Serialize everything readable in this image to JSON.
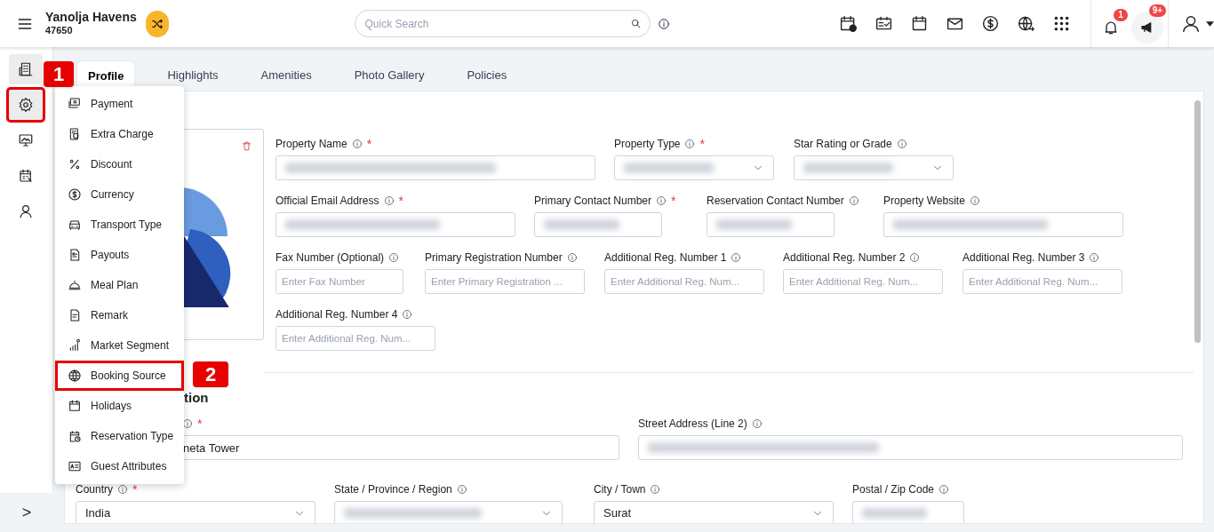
{
  "header": {
    "property_name": "Yanolja Havens",
    "property_id": "47650",
    "search": {
      "placeholder": "Quick Search"
    },
    "notifications_badge": "1",
    "announcements_badge": "9+"
  },
  "sidebar": {
    "items": [
      {
        "selected": true
      },
      {
        "selected": true,
        "callout": "1"
      },
      {
        "selected": false
      },
      {
        "selected": false
      },
      {
        "selected": false
      }
    ],
    "expand_label": ">"
  },
  "settings_menu": {
    "items": [
      {
        "label": "Payment"
      },
      {
        "label": "Extra Charge"
      },
      {
        "label": "Discount"
      },
      {
        "label": "Currency"
      },
      {
        "label": "Transport Type"
      },
      {
        "label": "Payouts"
      },
      {
        "label": "Meal Plan"
      },
      {
        "label": "Remark"
      },
      {
        "label": "Market Segment"
      },
      {
        "label": "Booking Source",
        "callout": "2"
      },
      {
        "label": "Holidays"
      },
      {
        "label": "Reservation Type"
      },
      {
        "label": "Guest Attributes"
      }
    ]
  },
  "tabs": [
    {
      "label": "Profile",
      "selected": true
    },
    {
      "label": "Highlights",
      "selected": false
    },
    {
      "label": "Amenities",
      "selected": false
    },
    {
      "label": "Photo Gallery",
      "selected": false
    },
    {
      "label": "Policies",
      "selected": false
    }
  ],
  "property_form": {
    "rows": [
      [
        {
          "label": "Property Name",
          "required_mark": "*",
          "kind": "text",
          "redacted": true
        },
        {
          "label": "Property Type",
          "required_mark": "*",
          "kind": "select",
          "redacted": true
        },
        {
          "label": "Star Rating or Grade",
          "kind": "select",
          "redacted": true
        }
      ],
      [
        {
          "label": "Official Email Address",
          "required_mark": "*",
          "kind": "text",
          "redacted": true
        },
        {
          "label": "Primary Contact Number",
          "required_mark": "*",
          "kind": "text",
          "redacted": true
        },
        {
          "label": "Reservation Contact Number",
          "kind": "text",
          "redacted": true
        },
        {
          "label": "Property Website",
          "kind": "text",
          "redacted": true
        }
      ],
      [
        {
          "label": "Fax Number (Optional)",
          "kind": "text",
          "placeholder": "Enter Fax Number"
        },
        {
          "label": "Primary Registration Number",
          "kind": "text",
          "placeholder": "Enter Primary Registration ..."
        },
        {
          "label": "Additional Reg. Number 1",
          "kind": "text",
          "placeholder": "Enter Additional Reg. Num..."
        },
        {
          "label": "Additional Reg. Number 2",
          "kind": "text",
          "placeholder": "Enter Additional Reg. Num..."
        },
        {
          "label": "Additional Reg. Number 3",
          "kind": "text",
          "placeholder": "Enter Additional Reg. Num..."
        }
      ],
      [
        {
          "label": "Additional Reg. Number 4",
          "kind": "text",
          "placeholder": "Enter Additional Reg. Num..."
        }
      ]
    ]
  },
  "address_section": {
    "heading": "tion",
    "rows": [
      [
        {
          "required_mark": "*",
          "kind": "text",
          "value": "neta Tower"
        },
        {
          "label": "Street Address (Line 2)",
          "kind": "text",
          "redacted": true
        }
      ],
      [
        {
          "label": "Country",
          "required_mark": "*",
          "kind": "select",
          "value": "India"
        },
        {
          "label": "State / Province / Region",
          "kind": "select",
          "redacted": true
        },
        {
          "label": "City / Town",
          "kind": "select",
          "value": "Surat"
        },
        {
          "label": "Postal / Zip Code",
          "kind": "text",
          "redacted": true
        }
      ]
    ]
  }
}
